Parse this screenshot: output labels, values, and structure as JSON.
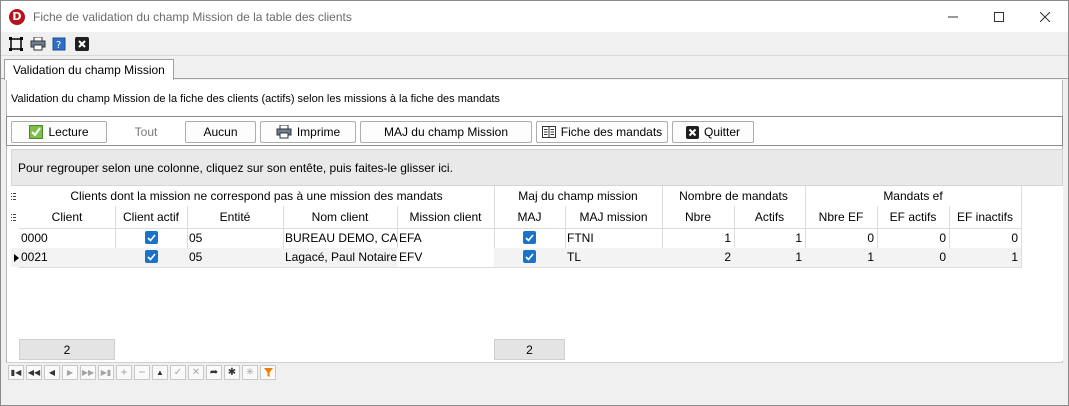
{
  "window": {
    "title": "Fiche de validation du champ Mission de la table des clients",
    "logo_letter": "D"
  },
  "tab": {
    "label": "Validation du champ Mission"
  },
  "description": "Validation du champ Mission de la fiche des clients (actifs) selon les missions à la fiche des mandats",
  "toolbar": {
    "lecture": "Lecture",
    "tout": "Tout",
    "aucun": "Aucun",
    "imprime": "Imprime",
    "maj": "MAJ du champ Mission",
    "fiche": "Fiche des mandats",
    "quitter": "Quitter"
  },
  "group_hint": "Pour regrouper selon une colonne, cliquez sur son entête, puis faites-le glisser ici.",
  "grid": {
    "bands": {
      "clients": "Clients dont la mission ne correspond pas à une mission des mandats",
      "maj": "Maj du champ mission",
      "nombre": "Nombre de mandats",
      "ef": "Mandats ef"
    },
    "columns": {
      "client": "Client",
      "client_actif": "Client actif",
      "entite": "Entité",
      "nom_client": "Nom client",
      "mission_client": "Mission client",
      "maj": "MAJ",
      "maj_mission": "MAJ mission",
      "nbre": "Nbre",
      "actifs": "Actifs",
      "nbre_ef": "Nbre EF",
      "ef_actifs": "EF actifs",
      "ef_inactifs": "EF inactifs"
    },
    "rows": [
      {
        "client": "0000",
        "client_actif": true,
        "entite": "05",
        "nom_client": "BUREAU DEMO, CA",
        "mission_client": "EFA",
        "maj": true,
        "maj_mission": "FTNI",
        "nbre": "1",
        "actifs": "1",
        "nbre_ef": "0",
        "ef_actifs": "0",
        "ef_inactifs": "0"
      },
      {
        "client": "0021",
        "client_actif": true,
        "entite": "05",
        "nom_client": "Lagacé, Paul Notaire",
        "mission_client": "EFV",
        "maj": true,
        "maj_mission": "TL",
        "nbre": "2",
        "actifs": "1",
        "nbre_ef": "1",
        "ef_actifs": "0",
        "ef_inactifs": "1"
      }
    ],
    "footer": {
      "client_count": "2",
      "maj_count": "2"
    }
  },
  "colors": {
    "accent": "#1a73c8",
    "logo": "#b5121b"
  }
}
